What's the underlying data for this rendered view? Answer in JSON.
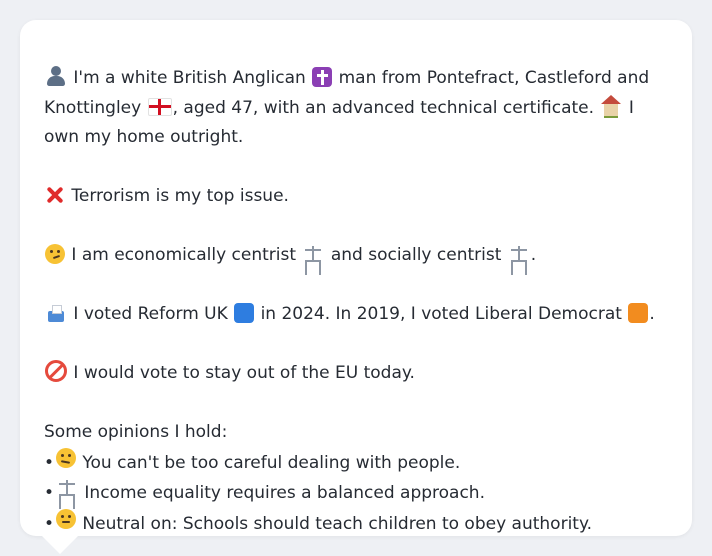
{
  "intro": {
    "part1": "I'm a white British Anglican",
    "part2": "man from Pontefract, Castleford and Knottingley",
    "part3": ", aged 47, with an advanced technical certificate.",
    "part4": "I own my home outright."
  },
  "top_issue": "Terrorism is my top issue.",
  "economics": {
    "part1": "I am economically centrist",
    "part2": "and socially centrist",
    "part3": "."
  },
  "votes": {
    "part1": "I voted Reform UK",
    "part2": "in 2024. In 2019, I voted Liberal Democrat",
    "part3": "."
  },
  "eu": "I would vote to stay out of the EU today.",
  "opinions": {
    "heading": "Some opinions I hold:",
    "items": [
      "You can't be too careful dealing with people.",
      "Income equality requires a balanced approach.",
      "Neutral on: Schools should teach children to obey authority."
    ],
    "bullet_char": "•"
  },
  "icons": {
    "person": "person-icon",
    "cross": "latin-cross-icon",
    "flag": "england-flag-icon",
    "house": "house-icon",
    "x": "cross-mark-icon",
    "thinking": "thinking-face-icon",
    "scales": "balance-scale-icon",
    "ballot": "ballot-box-icon",
    "blue_square": "blue-square-icon",
    "orange_square": "orange-square-icon",
    "no_entry": "prohibited-icon",
    "raised_eyebrow": "raised-eyebrow-face-icon",
    "neutral": "neutral-face-icon"
  },
  "colors": {
    "text": "#262b33",
    "background": "#eef0f4",
    "bubble": "#ffffff"
  }
}
